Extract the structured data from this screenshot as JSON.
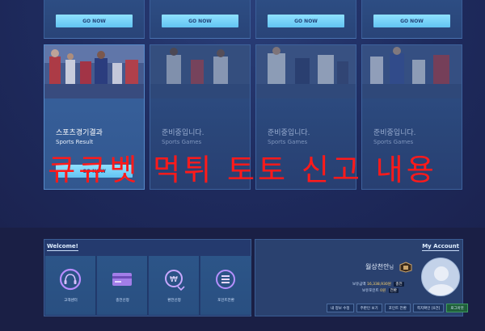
{
  "top_cards": [
    {
      "button": "GO NOW"
    },
    {
      "button": "GO NOW"
    },
    {
      "button": "GO NOW"
    },
    {
      "button": "GO NOW"
    }
  ],
  "cards": [
    {
      "title": "스포츠경기결과",
      "subtitle": "Sports Result",
      "button": "GO NOW",
      "active": true
    },
    {
      "title": "준비중입니다.",
      "subtitle": "Sports Games"
    },
    {
      "title": "준비중입니다.",
      "subtitle": "Sports Games"
    },
    {
      "title": "준비중입니다.",
      "subtitle": "Sports Games"
    }
  ],
  "watermark": "큐큐벳 먹튀 토토 신고 내용",
  "welcome": {
    "title": "Welcome!",
    "tiles": [
      {
        "label": "고객센터",
        "icon": "headset-icon"
      },
      {
        "label": "충전신청",
        "icon": "card-icon"
      },
      {
        "label": "환전신청",
        "icon": "won-coin-icon"
      },
      {
        "label": "포인트전환",
        "icon": "exchange-icon"
      }
    ]
  },
  "account": {
    "title": "My Account",
    "username": "월상천안",
    "username_suffix": "님",
    "balance_label": "보유금액",
    "balance_value": "16,338,930원",
    "balance_tag": "충전",
    "point_label": "보유포인트",
    "point_value": "0원",
    "point_tag": "전환",
    "actions": [
      "내 정보 수정",
      "주판인 보기",
      "포인트 전환",
      "쪽지확인 [0건]",
      "로그아웃"
    ]
  },
  "colors": {
    "accent_button": "#62c4f2",
    "watermark": "#ff1a1a",
    "panel": "#243a6e"
  }
}
